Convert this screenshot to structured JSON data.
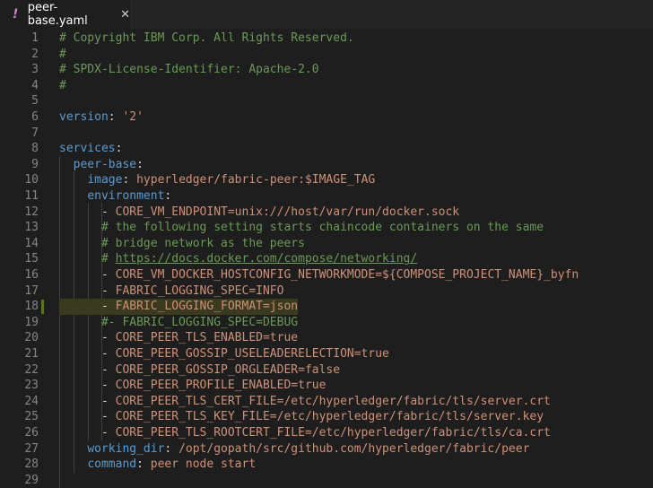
{
  "tab": {
    "icon": "yaml-exclamation-icon",
    "title": "peer-base.yaml",
    "close": "✕"
  },
  "lines": [
    {
      "n": "1",
      "parts": [
        {
          "t": "# Copyright IBM Corp. All Rights Reserved.",
          "c": "comment"
        }
      ]
    },
    {
      "n": "2",
      "parts": [
        {
          "t": "#",
          "c": "comment"
        }
      ]
    },
    {
      "n": "3",
      "parts": [
        {
          "t": "# SPDX-License-Identifier: Apache-2.0",
          "c": "comment"
        }
      ]
    },
    {
      "n": "4",
      "parts": [
        {
          "t": "#",
          "c": "comment"
        }
      ]
    },
    {
      "n": "5",
      "parts": []
    },
    {
      "n": "6",
      "parts": [
        {
          "t": "version",
          "c": "key"
        },
        {
          "t": ": ",
          "c": "punc"
        },
        {
          "t": "'2'",
          "c": "str"
        }
      ]
    },
    {
      "n": "7",
      "parts": []
    },
    {
      "n": "8",
      "parts": [
        {
          "t": "services",
          "c": "key"
        },
        {
          "t": ":",
          "c": "punc"
        }
      ]
    },
    {
      "n": "9",
      "parts": [
        {
          "t": "  ",
          "c": "punc"
        },
        {
          "t": "peer-base",
          "c": "key"
        },
        {
          "t": ":",
          "c": "punc"
        }
      ]
    },
    {
      "n": "10",
      "parts": [
        {
          "t": "    ",
          "c": "punc"
        },
        {
          "t": "image",
          "c": "key"
        },
        {
          "t": ": ",
          "c": "punc"
        },
        {
          "t": "hyperledger/fabric-peer:$IMAGE_TAG",
          "c": "str"
        }
      ]
    },
    {
      "n": "11",
      "parts": [
        {
          "t": "    ",
          "c": "punc"
        },
        {
          "t": "environment",
          "c": "key"
        },
        {
          "t": ":",
          "c": "punc"
        }
      ]
    },
    {
      "n": "12",
      "parts": [
        {
          "t": "      - ",
          "c": "punc"
        },
        {
          "t": "CORE_VM_ENDPOINT=unix:///host/var/run/docker.sock",
          "c": "str"
        }
      ]
    },
    {
      "n": "13",
      "parts": [
        {
          "t": "      ",
          "c": "punc"
        },
        {
          "t": "# the following setting starts chaincode containers on the same",
          "c": "comment"
        }
      ]
    },
    {
      "n": "14",
      "parts": [
        {
          "t": "      ",
          "c": "punc"
        },
        {
          "t": "# bridge network as the peers",
          "c": "comment"
        }
      ]
    },
    {
      "n": "15",
      "parts": [
        {
          "t": "      ",
          "c": "punc"
        },
        {
          "t": "# ",
          "c": "comment"
        },
        {
          "t": "https://docs.docker.com/compose/networking/",
          "c": "link"
        }
      ]
    },
    {
      "n": "16",
      "parts": [
        {
          "t": "      - ",
          "c": "punc"
        },
        {
          "t": "CORE_VM_DOCKER_HOSTCONFIG_NETWORKMODE=${COMPOSE_PROJECT_NAME}_byfn",
          "c": "str"
        }
      ]
    },
    {
      "n": "17",
      "parts": [
        {
          "t": "      - ",
          "c": "punc"
        },
        {
          "t": "FABRIC_LOGGING_SPEC=INFO",
          "c": "str"
        }
      ]
    },
    {
      "n": "18",
      "parts": [
        {
          "t": "      - ",
          "c": "punc"
        },
        {
          "t": "FABRIC_LOGGING_FORMAT=json",
          "c": "str"
        }
      ],
      "highlight": true,
      "modified": true
    },
    {
      "n": "19",
      "parts": [
        {
          "t": "      ",
          "c": "punc"
        },
        {
          "t": "#- FABRIC_LOGGING_SPEC=DEBUG",
          "c": "comment"
        }
      ]
    },
    {
      "n": "20",
      "parts": [
        {
          "t": "      - ",
          "c": "punc"
        },
        {
          "t": "CORE_PEER_TLS_ENABLED=true",
          "c": "str"
        }
      ]
    },
    {
      "n": "21",
      "parts": [
        {
          "t": "      - ",
          "c": "punc"
        },
        {
          "t": "CORE_PEER_GOSSIP_USELEADERELECTION=true",
          "c": "str"
        }
      ]
    },
    {
      "n": "22",
      "parts": [
        {
          "t": "      - ",
          "c": "punc"
        },
        {
          "t": "CORE_PEER_GOSSIP_ORGLEADER=false",
          "c": "str"
        }
      ]
    },
    {
      "n": "23",
      "parts": [
        {
          "t": "      - ",
          "c": "punc"
        },
        {
          "t": "CORE_PEER_PROFILE_ENABLED=true",
          "c": "str"
        }
      ]
    },
    {
      "n": "24",
      "parts": [
        {
          "t": "      - ",
          "c": "punc"
        },
        {
          "t": "CORE_PEER_TLS_CERT_FILE=/etc/hyperledger/fabric/tls/server.crt",
          "c": "str"
        }
      ]
    },
    {
      "n": "25",
      "parts": [
        {
          "t": "      - ",
          "c": "punc"
        },
        {
          "t": "CORE_PEER_TLS_KEY_FILE=/etc/hyperledger/fabric/tls/server.key",
          "c": "str"
        }
      ]
    },
    {
      "n": "26",
      "parts": [
        {
          "t": "      - ",
          "c": "punc"
        },
        {
          "t": "CORE_PEER_TLS_ROOTCERT_FILE=/etc/hyperledger/fabric/tls/ca.crt",
          "c": "str"
        }
      ]
    },
    {
      "n": "27",
      "parts": [
        {
          "t": "    ",
          "c": "punc"
        },
        {
          "t": "working_dir",
          "c": "key"
        },
        {
          "t": ": ",
          "c": "punc"
        },
        {
          "t": "/opt/gopath/src/github.com/hyperledger/fabric/peer",
          "c": "str"
        }
      ]
    },
    {
      "n": "28",
      "parts": [
        {
          "t": "    ",
          "c": "punc"
        },
        {
          "t": "command",
          "c": "key"
        },
        {
          "t": ": ",
          "c": "punc"
        },
        {
          "t": "peer node start",
          "c": "str"
        }
      ]
    },
    {
      "n": "29",
      "parts": []
    }
  ]
}
